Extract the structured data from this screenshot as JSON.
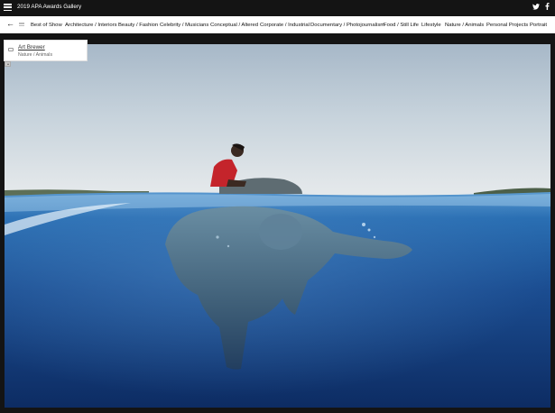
{
  "app": {
    "title": "2019 APA Awards Gallery"
  },
  "nav": {
    "back_glyph": "←",
    "categories": [
      "Best of Show",
      "Architecture / Interiors",
      "Beauty / Fashion",
      "Celebrity / Musicians",
      "Conceptual / Altered",
      "Corporate / Industrial",
      "Documentary / Photojournalism",
      "Food / Still Life",
      "Lifestyle",
      "Nature / Animals",
      "Personal Projects",
      "Portrait"
    ]
  },
  "photo": {
    "photographer": "Art Brewer",
    "category": "Nature / Animals"
  },
  "icons": {
    "menu": "hamburger-icon",
    "back": "arrow-left-icon",
    "grid": "grid-icon",
    "twitter": "twitter-icon",
    "facebook": "facebook-icon",
    "camera": "camera-icon",
    "collapse": "chevron-up-icon"
  },
  "colors": {
    "topbar": "#141414",
    "navbar": "#ffffff",
    "water": "#1a4a8e",
    "sky": "#e1e6e9"
  }
}
